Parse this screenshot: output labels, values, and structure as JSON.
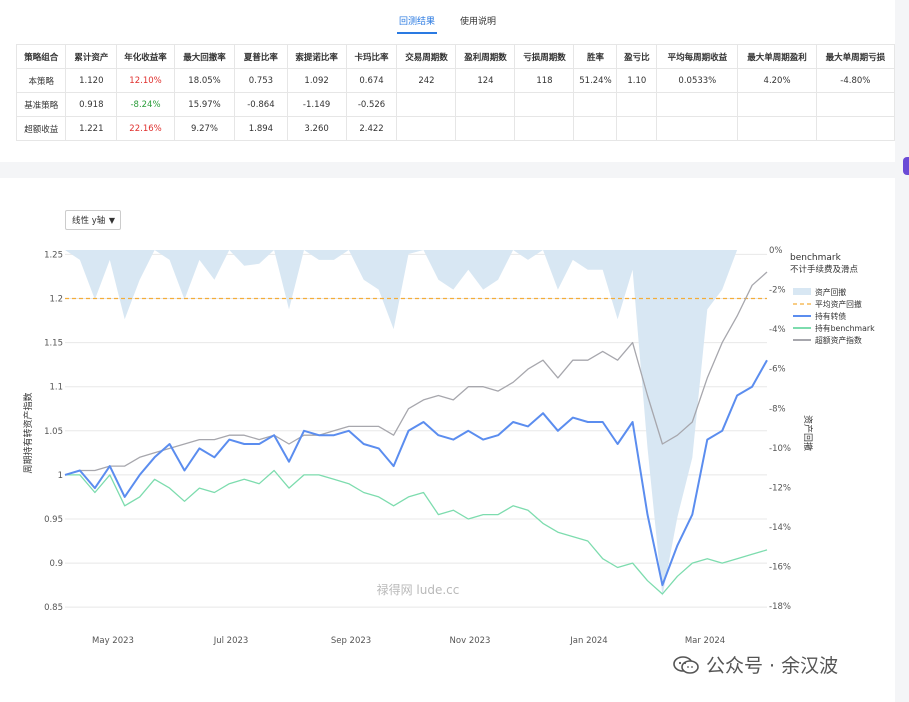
{
  "tabs": [
    {
      "label": "回测结果",
      "active": true
    },
    {
      "label": "使用说明",
      "active": false
    }
  ],
  "stats_table": {
    "headers": [
      "策略组合",
      "累计资产",
      "年化收益率",
      "最大回撤率",
      "夏普比率",
      "索提诺比率",
      "卡玛比率",
      "交易周期数",
      "盈利周期数",
      "亏损周期数",
      "胜率",
      "盈亏比",
      "平均每周期收益",
      "最大单周期盈利",
      "最大单周期亏损"
    ],
    "rows": [
      {
        "cells": [
          "本策略",
          "1.120",
          "12.10%",
          "18.05%",
          "0.753",
          "1.092",
          "0.674",
          "242",
          "124",
          "118",
          "51.24%",
          "1.10",
          "0.0533%",
          "4.20%",
          "-4.80%"
        ],
        "annual_sign": "pos"
      },
      {
        "cells": [
          "基准策略",
          "0.918",
          "-8.24%",
          "15.97%",
          "-0.864",
          "-1.149",
          "-0.526",
          "",
          "",
          "",
          "",
          "",
          "",
          "",
          ""
        ],
        "annual_sign": "neg"
      },
      {
        "cells": [
          "超额收益",
          "1.221",
          "22.16%",
          "9.27%",
          "1.894",
          "3.260",
          "2.422",
          "",
          "",
          "",
          "",
          "",
          "",
          "",
          ""
        ],
        "annual_sign": "pos"
      }
    ]
  },
  "axis_select": {
    "label": "线性 y轴"
  },
  "watermark_center": "禄得网 lude.cc",
  "watermark_brand": "公众号 · 余汉波",
  "colors": {
    "strategy": "#5b8def",
    "benchmark": "#7ddcae",
    "excess": "#a7a7ad",
    "drawdown": "#d8e7f3",
    "avgdd": "#f3ad3a"
  },
  "chart_data": {
    "type": "line",
    "x_ticks": [
      "May 2023",
      "Jul 2023",
      "Sep 2023",
      "Nov 2023",
      "Jan 2024",
      "Mar 2024"
    ],
    "y_left": {
      "label": "周期持有转资产指数",
      "ticks": [
        0.85,
        0.9,
        0.95,
        1,
        1.05,
        1.1,
        1.15,
        1.2,
        1.25
      ],
      "range": [
        0.84,
        1.255
      ]
    },
    "y_right": {
      "label": "资产回撤",
      "ticks": [
        "0%",
        "-2%",
        "-4%",
        "-6%",
        "-8%",
        "-10%",
        "-12%",
        "-14%",
        "-16%",
        "-18%"
      ],
      "range": [
        -18.5,
        0
      ]
    },
    "legend": {
      "title": "benchmark",
      "subtitle": "不计手续费及滑点",
      "items": [
        "资产回撤",
        "平均资产回撤",
        "持有转债",
        "持有benchmark",
        "超额资产指数"
      ]
    },
    "avg_drawdown_level": 1.2,
    "series": [
      {
        "name": "持有转债",
        "values": [
          1.0,
          1.005,
          0.985,
          1.01,
          0.975,
          1.0,
          1.02,
          1.035,
          1.005,
          1.03,
          1.02,
          1.04,
          1.035,
          1.035,
          1.045,
          1.015,
          1.05,
          1.045,
          1.045,
          1.05,
          1.035,
          1.03,
          1.01,
          1.05,
          1.06,
          1.045,
          1.04,
          1.05,
          1.04,
          1.045,
          1.06,
          1.055,
          1.07,
          1.05,
          1.065,
          1.06,
          1.06,
          1.035,
          1.06,
          0.955,
          0.875,
          0.92,
          0.955,
          1.04,
          1.05,
          1.09,
          1.1,
          1.13
        ]
      },
      {
        "name": "持有benchmark",
        "values": [
          1.0,
          1.0,
          0.98,
          1.0,
          0.965,
          0.975,
          0.995,
          0.985,
          0.97,
          0.985,
          0.98,
          0.99,
          0.995,
          0.99,
          1.005,
          0.985,
          1.0,
          1.0,
          0.995,
          0.99,
          0.98,
          0.975,
          0.965,
          0.975,
          0.98,
          0.955,
          0.96,
          0.95,
          0.955,
          0.955,
          0.965,
          0.96,
          0.945,
          0.935,
          0.93,
          0.925,
          0.905,
          0.895,
          0.9,
          0.88,
          0.865,
          0.885,
          0.9,
          0.905,
          0.9,
          0.905,
          0.91,
          0.915
        ]
      },
      {
        "name": "超额资产指数",
        "values": [
          1.0,
          1.005,
          1.005,
          1.01,
          1.01,
          1.02,
          1.025,
          1.03,
          1.035,
          1.04,
          1.04,
          1.045,
          1.045,
          1.04,
          1.045,
          1.035,
          1.045,
          1.045,
          1.05,
          1.055,
          1.055,
          1.055,
          1.045,
          1.075,
          1.085,
          1.09,
          1.085,
          1.1,
          1.1,
          1.095,
          1.105,
          1.12,
          1.13,
          1.11,
          1.13,
          1.13,
          1.14,
          1.13,
          1.15,
          1.09,
          1.035,
          1.045,
          1.06,
          1.11,
          1.15,
          1.18,
          1.215,
          1.23
        ]
      },
      {
        "name": "资产回撤",
        "values": [
          0,
          -0.5,
          -2.5,
          -0.5,
          -3.5,
          -1.5,
          0,
          -0.5,
          -2.5,
          -0.5,
          -1.5,
          0,
          -0.8,
          -0.7,
          0,
          -3.0,
          0,
          -0.5,
          -0.5,
          0,
          -1.5,
          -2.0,
          -4.0,
          -0.2,
          0,
          -1.5,
          -2.0,
          -1.0,
          -2.0,
          -1.5,
          0,
          -0.5,
          0,
          -2.0,
          -0.5,
          -1.0,
          -1.0,
          -3.5,
          -1.0,
          -10.0,
          -17.5,
          -13.5,
          -10.5,
          -3.0,
          -2.0,
          0,
          0,
          0
        ]
      }
    ]
  }
}
